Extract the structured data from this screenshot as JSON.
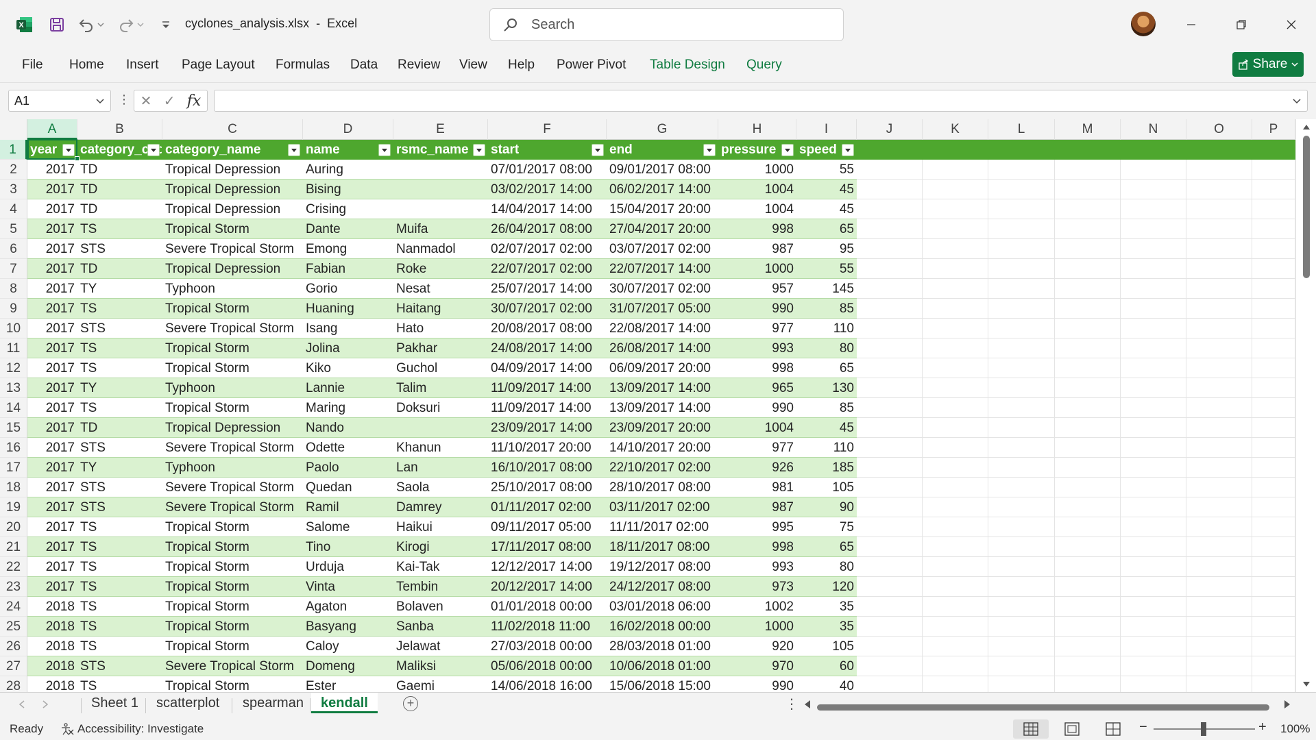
{
  "app": {
    "file_name": "cyclones_analysis.xlsx",
    "separator": "-",
    "app_name": "Excel",
    "search_placeholder": "Search"
  },
  "ribbon": {
    "tabs": [
      "File",
      "Home",
      "Insert",
      "Page Layout",
      "Formulas",
      "Data",
      "Review",
      "View",
      "Help",
      "Power Pivot",
      "Table Design",
      "Query"
    ],
    "share_label": "Share"
  },
  "formula_bar": {
    "name_box": "A1",
    "fx_label": "fx",
    "formula": ""
  },
  "columns": [
    "A",
    "B",
    "C",
    "D",
    "E",
    "F",
    "G",
    "H",
    "I",
    "J",
    "K",
    "L",
    "M",
    "N",
    "O",
    "P"
  ],
  "table": {
    "headers": [
      "year",
      "category_code",
      "category_name",
      "name",
      "rsmc_name",
      "start",
      "end",
      "pressure",
      "speed"
    ],
    "rows": [
      [
        "2017",
        "TD",
        "Tropical Depression",
        "Auring",
        "",
        "07/01/2017 08:00",
        "09/01/2017 08:00",
        "1000",
        "55"
      ],
      [
        "2017",
        "TD",
        "Tropical Depression",
        "Bising",
        "",
        "03/02/2017 14:00",
        "06/02/2017 14:00",
        "1004",
        "45"
      ],
      [
        "2017",
        "TD",
        "Tropical Depression",
        "Crising",
        "",
        "14/04/2017 14:00",
        "15/04/2017 20:00",
        "1004",
        "45"
      ],
      [
        "2017",
        "TS",
        "Tropical Storm",
        "Dante",
        "Muifa",
        "26/04/2017 08:00",
        "27/04/2017 20:00",
        "998",
        "65"
      ],
      [
        "2017",
        "STS",
        "Severe Tropical Storm",
        "Emong",
        "Nanmadol",
        "02/07/2017 02:00",
        "03/07/2017 02:00",
        "987",
        "95"
      ],
      [
        "2017",
        "TD",
        "Tropical Depression",
        "Fabian",
        "Roke",
        "22/07/2017 02:00",
        "22/07/2017 14:00",
        "1000",
        "55"
      ],
      [
        "2017",
        "TY",
        "Typhoon",
        "Gorio",
        "Nesat",
        "25/07/2017 14:00",
        "30/07/2017 02:00",
        "957",
        "145"
      ],
      [
        "2017",
        "TS",
        "Tropical Storm",
        "Huaning",
        "Haitang",
        "30/07/2017 02:00",
        "31/07/2017 05:00",
        "990",
        "85"
      ],
      [
        "2017",
        "STS",
        "Severe Tropical Storm",
        "Isang",
        "Hato",
        "20/08/2017 08:00",
        "22/08/2017 14:00",
        "977",
        "110"
      ],
      [
        "2017",
        "TS",
        "Tropical Storm",
        "Jolina",
        "Pakhar",
        "24/08/2017 14:00",
        "26/08/2017 14:00",
        "993",
        "80"
      ],
      [
        "2017",
        "TS",
        "Tropical Storm",
        "Kiko",
        "Guchol",
        "04/09/2017 14:00",
        "06/09/2017 20:00",
        "998",
        "65"
      ],
      [
        "2017",
        "TY",
        "Typhoon",
        "Lannie",
        "Talim",
        "11/09/2017 14:00",
        "13/09/2017 14:00",
        "965",
        "130"
      ],
      [
        "2017",
        "TS",
        "Tropical Storm",
        "Maring",
        "Doksuri",
        "11/09/2017 14:00",
        "13/09/2017 14:00",
        "990",
        "85"
      ],
      [
        "2017",
        "TD",
        "Tropical Depression",
        "Nando",
        "",
        "23/09/2017 14:00",
        "23/09/2017 20:00",
        "1004",
        "45"
      ],
      [
        "2017",
        "STS",
        "Severe Tropical Storm",
        "Odette",
        "Khanun",
        "11/10/2017 20:00",
        "14/10/2017 20:00",
        "977",
        "110"
      ],
      [
        "2017",
        "TY",
        "Typhoon",
        "Paolo",
        "Lan",
        "16/10/2017 08:00",
        "22/10/2017 02:00",
        "926",
        "185"
      ],
      [
        "2017",
        "STS",
        "Severe Tropical Storm",
        "Quedan",
        "Saola",
        "25/10/2017 08:00",
        "28/10/2017 08:00",
        "981",
        "105"
      ],
      [
        "2017",
        "STS",
        "Severe Tropical Storm",
        "Ramil",
        "Damrey",
        "01/11/2017 02:00",
        "03/11/2017 02:00",
        "987",
        "90"
      ],
      [
        "2017",
        "TS",
        "Tropical Storm",
        "Salome",
        "Haikui",
        "09/11/2017 05:00",
        "11/11/2017 02:00",
        "995",
        "75"
      ],
      [
        "2017",
        "TS",
        "Tropical Storm",
        "Tino",
        "Kirogi",
        "17/11/2017 08:00",
        "18/11/2017 08:00",
        "998",
        "65"
      ],
      [
        "2017",
        "TS",
        "Tropical Storm",
        "Urduja",
        "Kai-Tak",
        "12/12/2017 14:00",
        "19/12/2017 08:00",
        "993",
        "80"
      ],
      [
        "2017",
        "TS",
        "Tropical Storm",
        "Vinta",
        "Tembin",
        "20/12/2017 14:00",
        "24/12/2017 08:00",
        "973",
        "120"
      ],
      [
        "2018",
        "TS",
        "Tropical Storm",
        "Agaton",
        "Bolaven",
        "01/01/2018 00:00",
        "03/01/2018 06:00",
        "1002",
        "35"
      ],
      [
        "2018",
        "TS",
        "Tropical Storm",
        "Basyang",
        "Sanba",
        "11/02/2018 11:00",
        "16/02/2018 00:00",
        "1000",
        "35"
      ],
      [
        "2018",
        "TS",
        "Tropical Storm",
        "Caloy",
        "Jelawat",
        "27/03/2018 00:00",
        "28/03/2018 01:00",
        "920",
        "105"
      ],
      [
        "2018",
        "STS",
        "Severe Tropical Storm",
        "Domeng",
        "Maliksi",
        "05/06/2018 00:00",
        "10/06/2018 01:00",
        "970",
        "60"
      ],
      [
        "2018",
        "TS",
        "Tropical Storm",
        "Ester",
        "Gaemi",
        "14/06/2018 16:00",
        "15/06/2018 15:00",
        "990",
        "40"
      ]
    ]
  },
  "row_numbers": [
    "1",
    "2",
    "3",
    "4",
    "5",
    "6",
    "7",
    "8",
    "9",
    "10",
    "11",
    "12",
    "13",
    "14",
    "15",
    "16",
    "17",
    "18",
    "19",
    "20",
    "21",
    "22",
    "23",
    "24",
    "25",
    "26",
    "27",
    "28"
  ],
  "sheets": [
    "Sheet 1",
    "scatterplot",
    "spearman",
    "kendall"
  ],
  "active_sheet": "kendall",
  "status": {
    "ready": "Ready",
    "accessibility": "Accessibility: Investigate",
    "zoom": "100%"
  },
  "colors": {
    "accent": "#107c41",
    "table_header": "#4ea72e",
    "table_band": "#daf2d0"
  }
}
